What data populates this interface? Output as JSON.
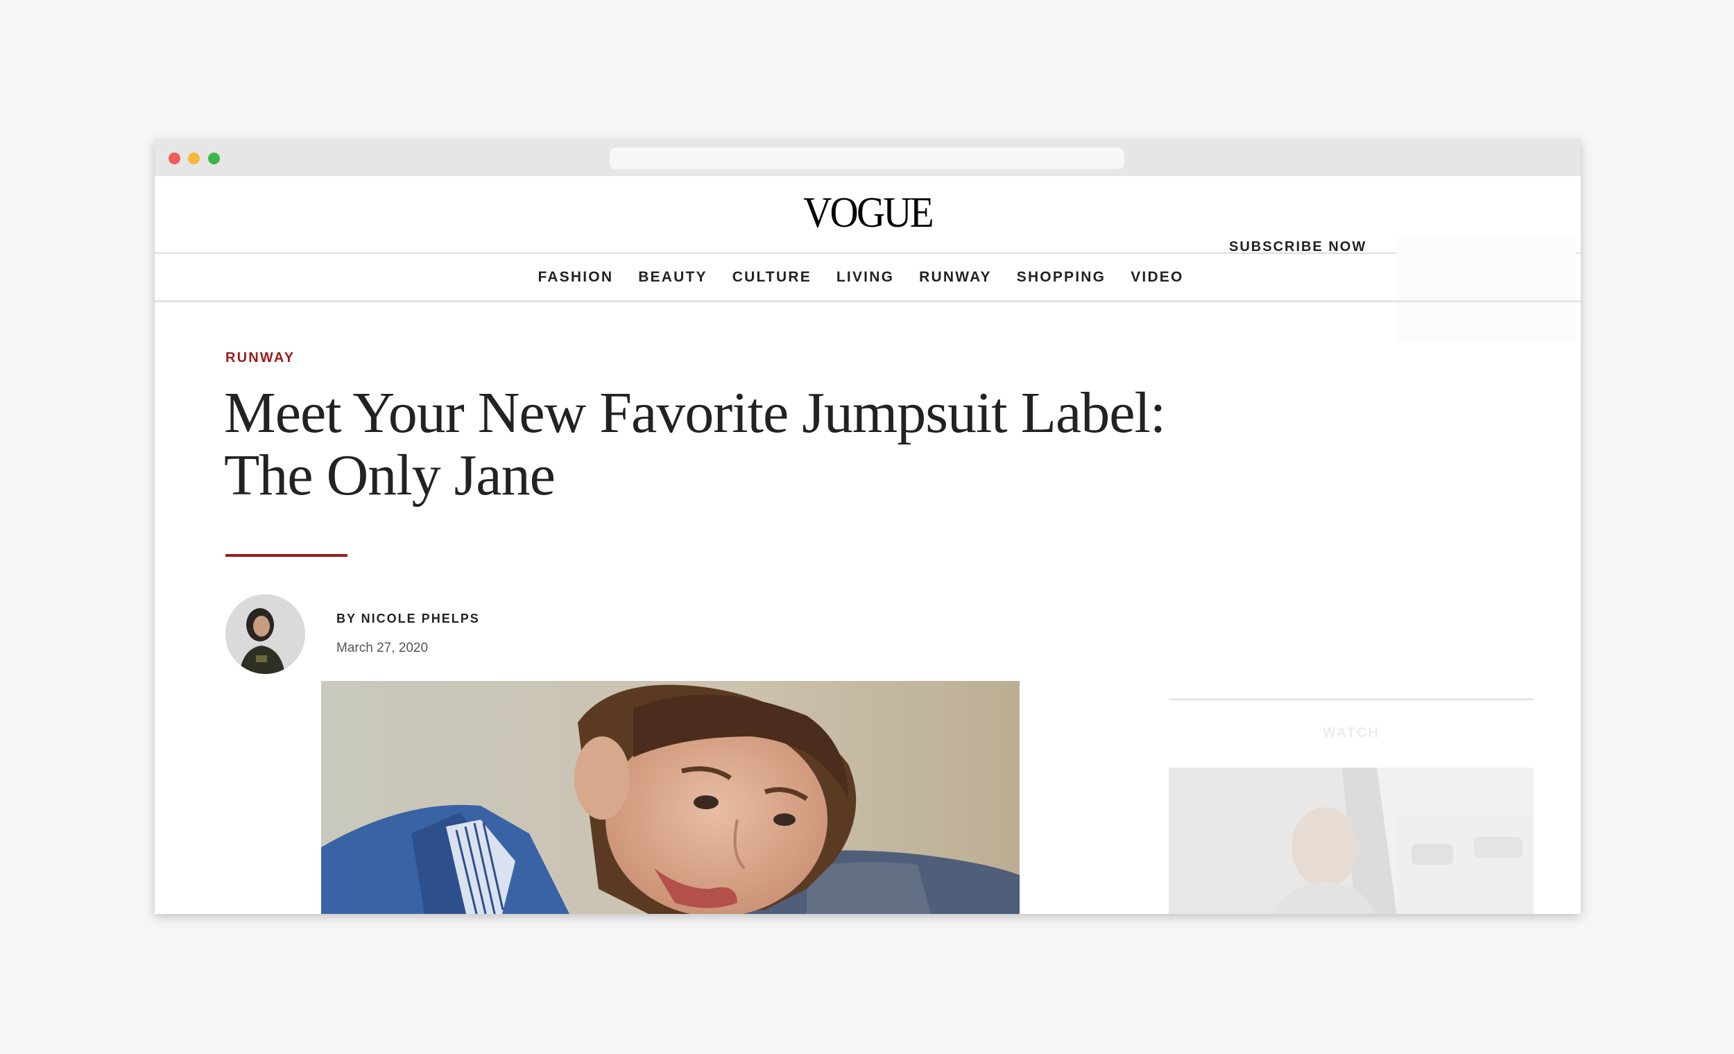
{
  "browser": {
    "url": ""
  },
  "header": {
    "logo": "VOGUE",
    "subscribe_label": "SUBSCRIBE NOW"
  },
  "nav": {
    "items": [
      {
        "label": "FASHION"
      },
      {
        "label": "BEAUTY"
      },
      {
        "label": "CULTURE"
      },
      {
        "label": "LIVING"
      },
      {
        "label": "RUNWAY"
      },
      {
        "label": "SHOPPING"
      },
      {
        "label": "VIDEO"
      }
    ]
  },
  "article": {
    "kicker": "RUNWAY",
    "headline_line1": "Meet Your New Favorite Jumpsuit Label:",
    "headline_line2": "The Only Jane",
    "byline": "BY NICOLE PHELPS",
    "date": "March 27, 2020"
  },
  "sidebar": {
    "section_label": "WATCH"
  },
  "colors": {
    "accent": "#9b1c1c",
    "text": "#222222",
    "page_bg": "#f6f6f6"
  }
}
